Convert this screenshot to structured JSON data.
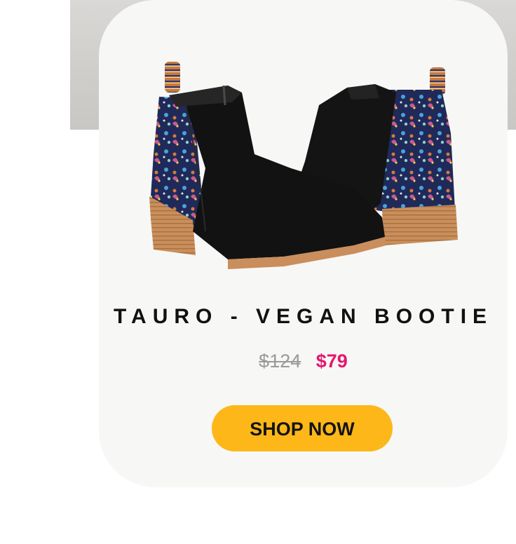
{
  "product": {
    "title": "TAURO - VEGAN BOOTIE",
    "price_old": "$124",
    "price_new": "$79",
    "cta_label": "SHOP NOW"
  },
  "colors": {
    "card_bg": "#f7f7f6",
    "cta_bg": "#fdb719",
    "price_new": "#e6166e",
    "price_old": "#9a9a9a"
  },
  "image": {
    "subject": "pair of black suede ankle boots with colorful paisley embroidered heel panels and stacked wooden heels"
  }
}
